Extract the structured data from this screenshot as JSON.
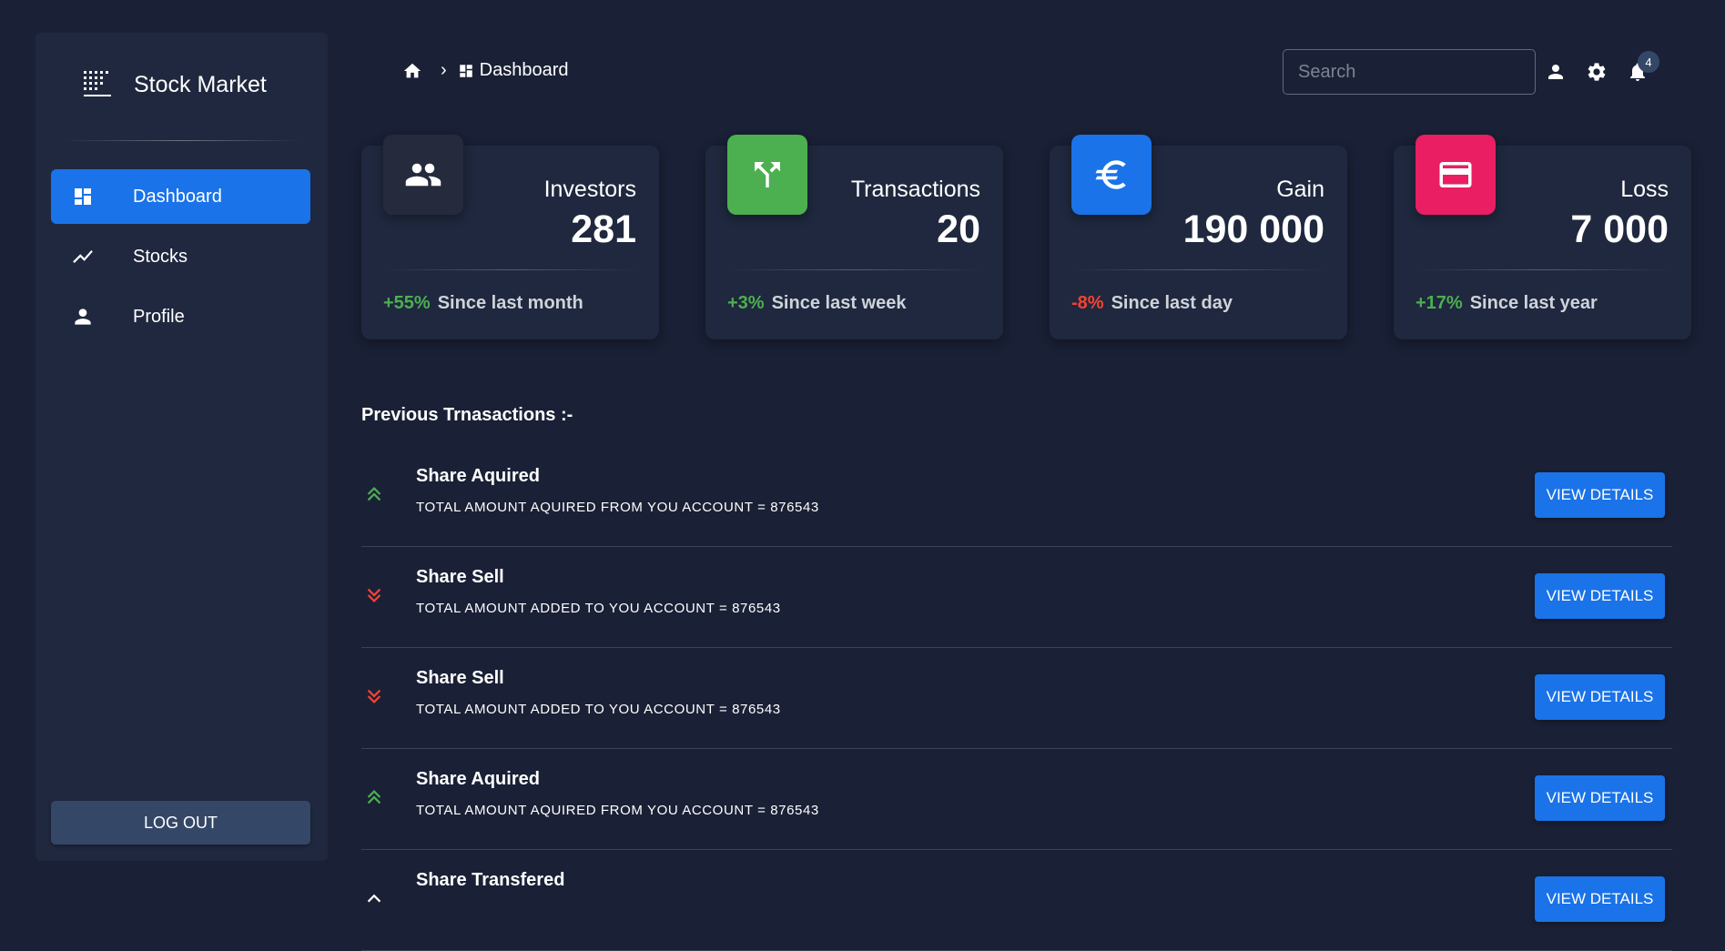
{
  "sidebar": {
    "brand": "Stock Market",
    "items": [
      {
        "label": "Dashboard",
        "icon": "dashboard-icon",
        "active": true
      },
      {
        "label": "Stocks",
        "icon": "trending-up-icon",
        "active": false
      },
      {
        "label": "Profile",
        "icon": "person-icon",
        "active": false
      }
    ],
    "logout": "LOG OUT"
  },
  "header": {
    "breadcrumb": {
      "current": "Dashboard",
      "separator": "›"
    },
    "search": {
      "placeholder": "Search",
      "value": ""
    },
    "notifications_count": "4"
  },
  "cards": [
    {
      "title": "Investors",
      "value": "281",
      "change": "+55%",
      "since": "Since last month",
      "change_color": "#4caf50",
      "icon": "people-icon",
      "icon_bg": "#252b3d"
    },
    {
      "title": "Transactions",
      "value": "20",
      "change": "+3%",
      "since": "Since last week",
      "change_color": "#4caf50",
      "icon": "call-split-icon",
      "icon_bg": "#4caf50"
    },
    {
      "title": "Gain",
      "value": "190 000",
      "change": "-8%",
      "since": "Since last day",
      "change_color": "#f44335",
      "icon": "euro-icon",
      "icon_bg": "#1a73e8"
    },
    {
      "title": "Loss",
      "value": "7 000",
      "change": "+17%",
      "since": "Since last year",
      "change_color": "#4caf50",
      "icon": "wallet-icon",
      "icon_bg": "#e91e63"
    }
  ],
  "transactions": {
    "title": "Previous Trnasactions :-",
    "button_label": "VIEW DETAILS",
    "items": [
      {
        "title": "Share Aquired",
        "desc": "TOTAL AMOUNT AQUIRED FROM YOU ACCOUNT = 876543",
        "direction": "up"
      },
      {
        "title": "Share Sell",
        "desc": "TOTAL AMOUNT ADDED TO YOU ACCOUNT = 876543",
        "direction": "down"
      },
      {
        "title": "Share Sell",
        "desc": "TOTAL AMOUNT ADDED TO YOU ACCOUNT = 876543",
        "direction": "down"
      },
      {
        "title": "Share Aquired",
        "desc": "TOTAL AMOUNT AQUIRED FROM YOU ACCOUNT = 876543",
        "direction": "up"
      },
      {
        "title": "Share Transfered",
        "desc": "",
        "direction": "neutral"
      }
    ]
  },
  "colors": {
    "up": "#4caf50",
    "down": "#f44335",
    "accent": "#1a73e8"
  }
}
